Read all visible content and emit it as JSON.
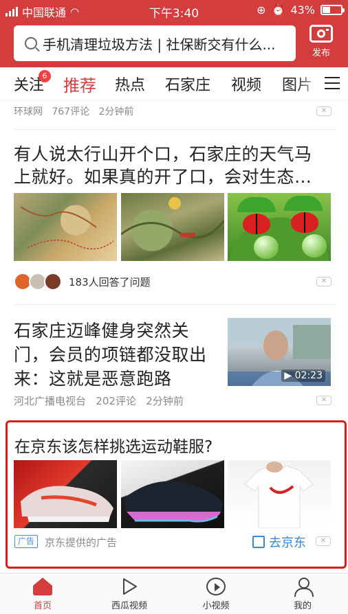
{
  "status_bar": {
    "carrier": "中国联通",
    "time": "下午3:40",
    "battery": "43%",
    "battery_level": 0.43
  },
  "search": {
    "text": "手机清理垃圾方法 | 社保断交有什么..."
  },
  "publish": {
    "label": "发布"
  },
  "tabs": [
    {
      "label": "关注",
      "badge": "6"
    },
    {
      "label": "推荐",
      "active": true
    },
    {
      "label": "热点"
    },
    {
      "label": "石家庄"
    },
    {
      "label": "视频"
    },
    {
      "label": "图片"
    }
  ],
  "feed": {
    "item0": {
      "source": "环球网",
      "comments": "767评论",
      "time": "2分钟前"
    },
    "item1": {
      "title_line1": "有人说太行山开个口，石家庄的天气马",
      "title_line2": "上就好。如果真的开了口，会对生态…",
      "answers": "183人回答了问题"
    },
    "item2": {
      "title_line1": "石家庄迈峰健身突然关",
      "title_line2": "门，会员的项链都没取出",
      "title_line3": "来：这就是恶意跑路",
      "source": "河北广播电视台",
      "comments": "202评论",
      "time": "2分钟前",
      "duration": "02:23"
    },
    "ad": {
      "title": "在京东该怎样挑选运动鞋服?",
      "tag": "广告",
      "provider": "京东提供的广告",
      "cta": "去京东"
    }
  },
  "bottom_nav": [
    {
      "label": "首页",
      "icon": "home-icon",
      "active": true
    },
    {
      "label": "西瓜视频",
      "icon": "play-icon"
    },
    {
      "label": "小视频",
      "icon": "short-video-icon"
    },
    {
      "label": "我的",
      "icon": "user-icon"
    }
  ],
  "colors": {
    "brand": "#d43d3d",
    "link": "#3b86d4",
    "ad_outline": "#e01a1a"
  }
}
